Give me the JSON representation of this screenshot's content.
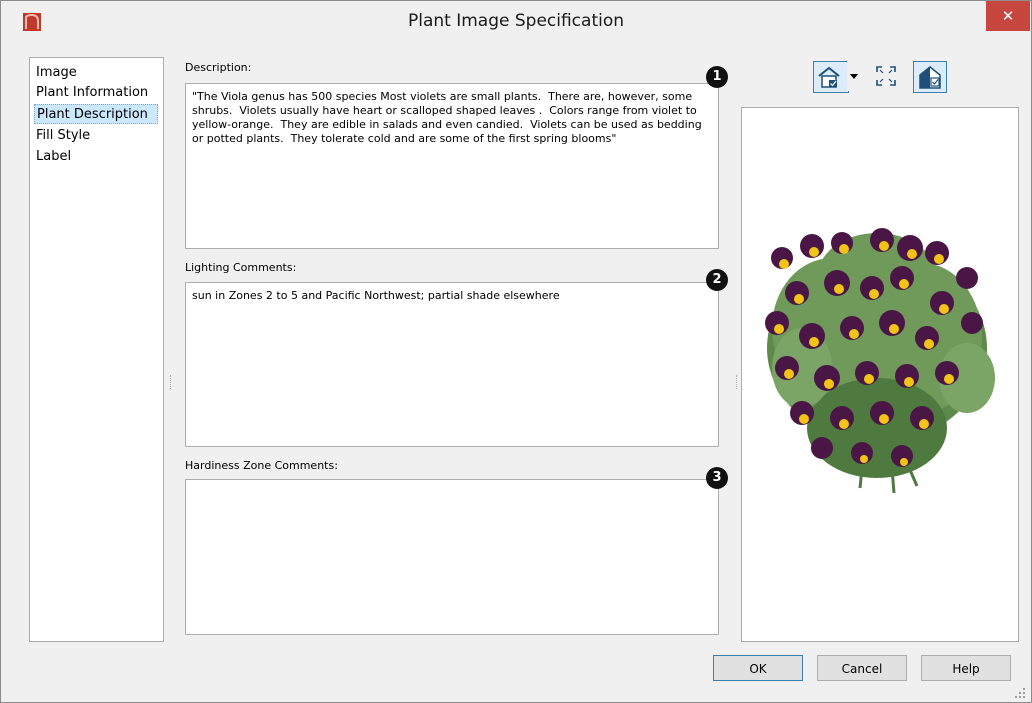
{
  "window": {
    "title": "Plant Image Specification",
    "close_label": "✕"
  },
  "nav": {
    "items": [
      {
        "label": "Image",
        "selected": false
      },
      {
        "label": "Plant Information",
        "selected": false
      },
      {
        "label": "Plant Description",
        "selected": true
      },
      {
        "label": "Fill Style",
        "selected": false
      },
      {
        "label": "Label",
        "selected": false
      }
    ]
  },
  "fields": {
    "description": {
      "label": "Description:",
      "value": "\"The Viola genus has 500 species Most violets are small plants.  There are, however, some shrubs.  Violets usually have heart or scalloped shaped leaves .  Colors range from violet to yellow-orange.  They are edible in salads and even candied.  Violets can be used as bedding or potted plants.  They tolerate cold and are some of the first spring blooms\"",
      "callout": "1"
    },
    "lighting": {
      "label": "Lighting Comments:",
      "value": "sun in Zones 2 to 5 and Pacific Northwest; partial shade elsewhere",
      "callout": "2"
    },
    "hardiness": {
      "label": "Hardiness Zone Comments:",
      "value": "",
      "callout": "3"
    }
  },
  "toolbar": {
    "icons": [
      "view-camera-icon",
      "fit-window-icon",
      "preview-options-icon"
    ]
  },
  "preview": {
    "subject": "plant-image"
  },
  "buttons": {
    "ok": "OK",
    "cancel": "Cancel",
    "help": "Help"
  },
  "colors": {
    "title_icon": "#c0392b",
    "close": "#c7463e",
    "selected_item": "#cce8ff",
    "flower_purple": "#4a1646",
    "flower_yellow": "#f2c418",
    "leaf_green": "#5d8a4a"
  }
}
